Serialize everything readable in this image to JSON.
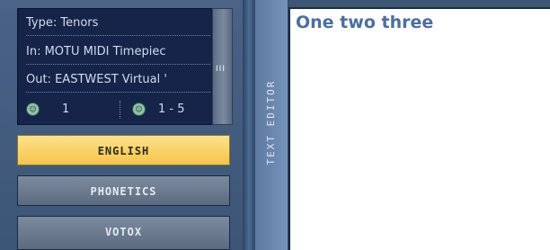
{
  "info_panel": {
    "type": "Type:  Tenors",
    "input": "In: MOTU MIDI Timepiec",
    "output": "Out: EASTWEST Virtual '",
    "channel_value": "1",
    "range_value": "1 - 5"
  },
  "scroll_grip": "III",
  "buttons": {
    "english": "ENGLISH",
    "phonetics": "PHONETICS",
    "votox": "VOTOX"
  },
  "side_tab": "TEXT EDITOR",
  "editor": {
    "text": "One two three"
  },
  "icons": {
    "channel": "midi-port-icon",
    "range": "midi-port-icon"
  },
  "colors": {
    "accent_button": "#f5c548",
    "panel_bg": "#16244a",
    "editor_text": "#4a6ea4"
  }
}
